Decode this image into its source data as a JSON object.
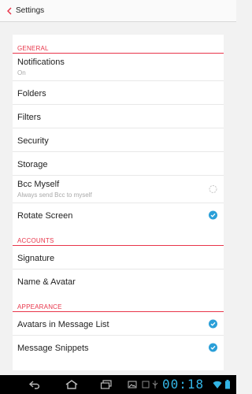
{
  "header": {
    "title": "Settings"
  },
  "sections": {
    "general": {
      "label": "GENERAL",
      "notifications": {
        "label": "Notifications",
        "sub": "On"
      },
      "folders": "Folders",
      "filters": "Filters",
      "security": "Security",
      "storage": "Storage",
      "bcc_myself": {
        "label": "Bcc Myself",
        "sub": "Always send Bcc to myself",
        "checked": false
      },
      "rotate_screen": {
        "label": "Rotate Screen",
        "checked": true
      }
    },
    "accounts": {
      "label": "ACCOUNTS",
      "signature": "Signature",
      "name_avatar": "Name & Avatar"
    },
    "appearance": {
      "label": "APPEARANCE",
      "avatars": {
        "label": "Avatars in Message List",
        "checked": true
      },
      "snippets": {
        "label": "Message Snippets",
        "checked": true
      }
    }
  },
  "system_bar": {
    "time": "00:18"
  },
  "colors": {
    "accent": "#e8354a",
    "check": "#2a9fd8",
    "clock": "#33b5e5"
  }
}
